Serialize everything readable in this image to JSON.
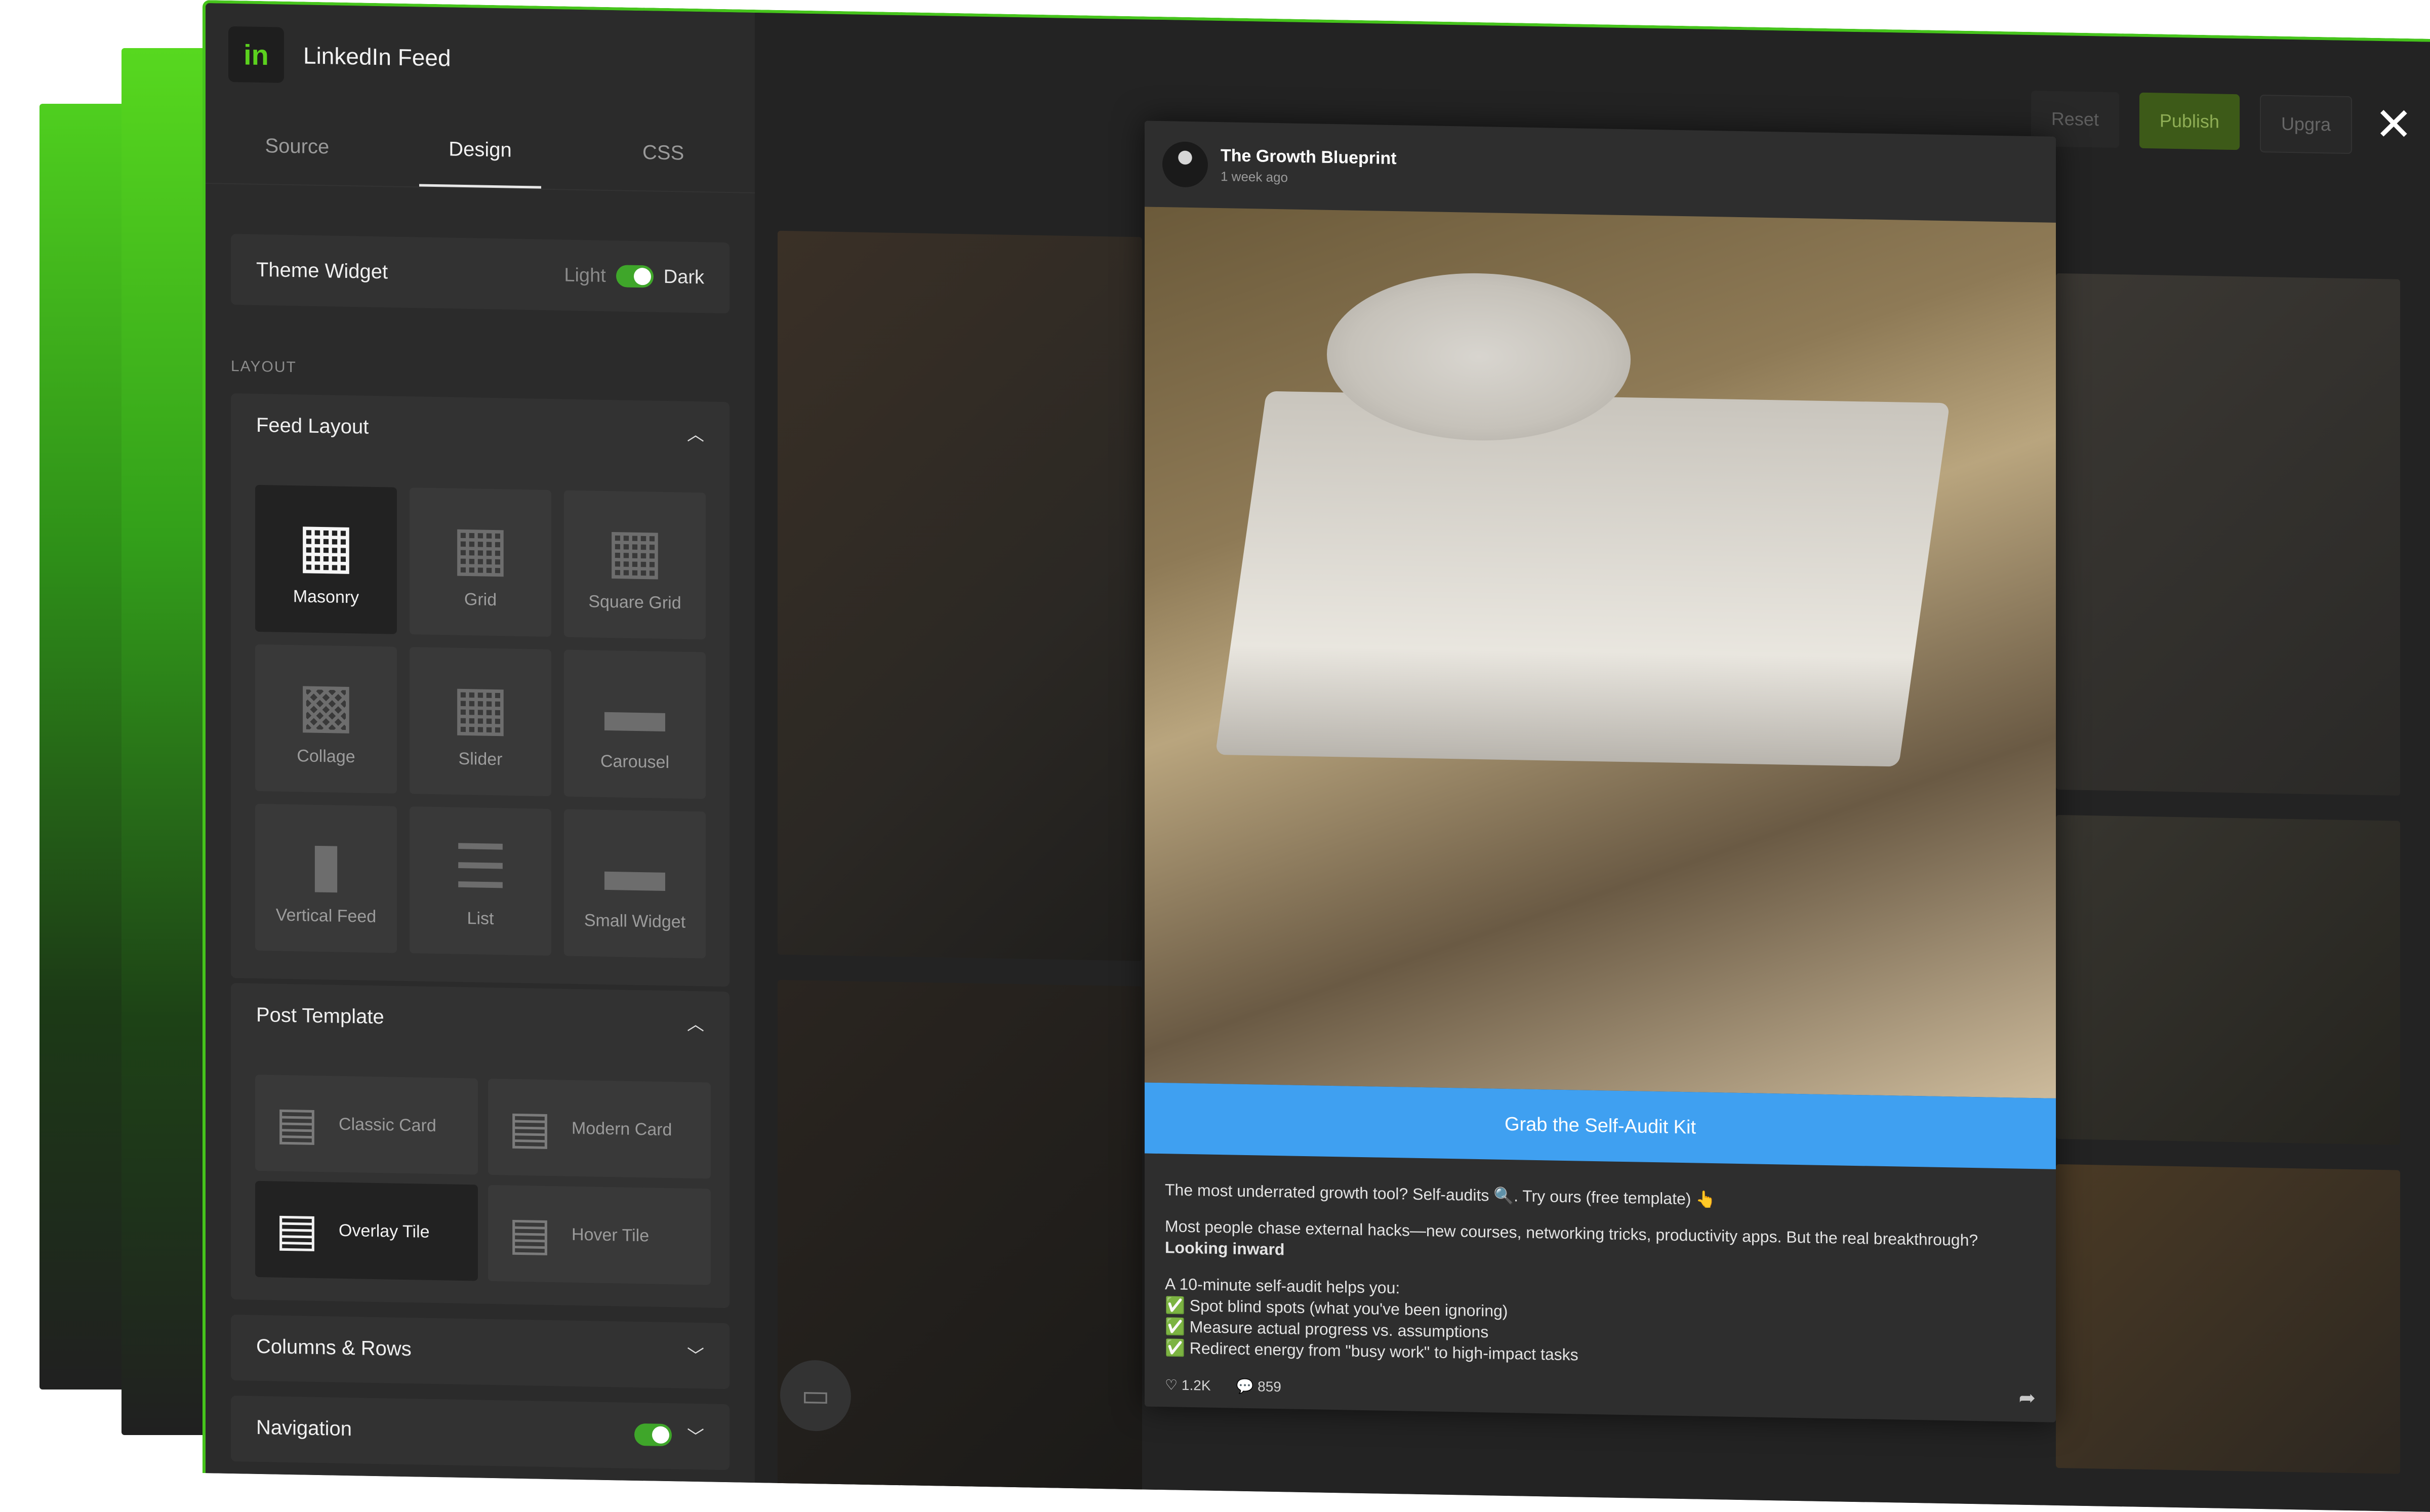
{
  "app": {
    "title": "LinkedIn Feed",
    "logo_text": "in"
  },
  "tabs": [
    {
      "label": "Source"
    },
    {
      "label": "Design"
    },
    {
      "label": "CSS"
    }
  ],
  "theme": {
    "label": "Theme Widget",
    "light": "Light",
    "dark": "Dark"
  },
  "section_layout": "LAYOUT",
  "feed_layout": {
    "title": "Feed Layout",
    "options": [
      "Masonry",
      "Grid",
      "Square Grid",
      "Collage",
      "Slider",
      "Carousel",
      "Vertical Feed",
      "List",
      "Small Widget"
    ]
  },
  "post_template": {
    "title": "Post Template",
    "options": [
      "Classic Card",
      "Modern Card",
      "Overlay Tile",
      "Hover Tile"
    ]
  },
  "columns_rows": "Columns & Rows",
  "navigation": "Navigation",
  "toolbar": {
    "reset": "Reset",
    "publish": "Publish",
    "upgrade": "Upgra"
  },
  "post": {
    "author": "The Growth Blueprint",
    "time": "1 week ago",
    "cta": "Grab the Self-Audit Kit",
    "line1": "The most underrated growth tool? Self-audits 🔍. Try ours (free template) 👆",
    "line2": "Most people chase external hacks—new courses, networking tricks, productivity apps. But the real breakthrough?",
    "line3": "Looking inward",
    "line4": "A 10-minute self-audit helps you:",
    "checks": [
      "Spot blind spots (what you've been ignoring)",
      "Measure actual progress vs. assumptions",
      "Redirect energy from \"busy work\" to high-impact tasks"
    ],
    "likes": "1.2K",
    "comments": "859"
  },
  "colors": {
    "accent": "#46c41c",
    "cta": "#3fa0f1",
    "sidebar": "#2b2b2b"
  }
}
